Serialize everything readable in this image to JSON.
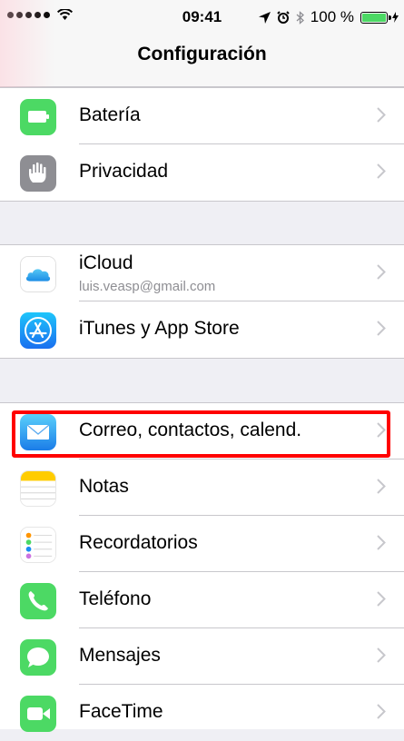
{
  "status_bar": {
    "time": "09:41",
    "battery_text": "100 %",
    "battery_level": 1.0,
    "icons": [
      "signal-dots-icon",
      "wifi-icon",
      "location-arrow-icon",
      "alarm-icon",
      "bluetooth-icon",
      "battery-icon",
      "charging-bolt-icon"
    ]
  },
  "nav": {
    "title": "Configuración"
  },
  "sections": [
    {
      "items": [
        {
          "label": "Batería",
          "icon": "battery-icon",
          "color": "#4cd964"
        },
        {
          "label": "Privacidad",
          "icon": "hand-icon",
          "color": "#8e8e93"
        }
      ]
    },
    {
      "items": [
        {
          "label": "iCloud",
          "sublabel": "luis.veasp@gmail.com",
          "icon": "cloud-icon",
          "color": "#ffffff"
        },
        {
          "label": "iTunes y App Store",
          "icon": "app-store-icon",
          "color": "#1a8cf2"
        }
      ]
    },
    {
      "items": [
        {
          "label": "Correo, contactos, calend.",
          "icon": "mail-envelope-icon",
          "color": "#3aa0f0",
          "highlighted": true
        },
        {
          "label": "Notas",
          "icon": "notes-icon",
          "color": "#ffcc00"
        },
        {
          "label": "Recordatorios",
          "icon": "reminders-icon",
          "color": "#ffffff"
        },
        {
          "label": "Teléfono",
          "icon": "phone-icon",
          "color": "#4cd964"
        },
        {
          "label": "Mensajes",
          "icon": "messages-icon",
          "color": "#4cd964"
        },
        {
          "label": "FaceTime",
          "icon": "facetime-icon",
          "color": "#4cd964"
        }
      ]
    }
  ],
  "highlight_color": "#ff0000"
}
